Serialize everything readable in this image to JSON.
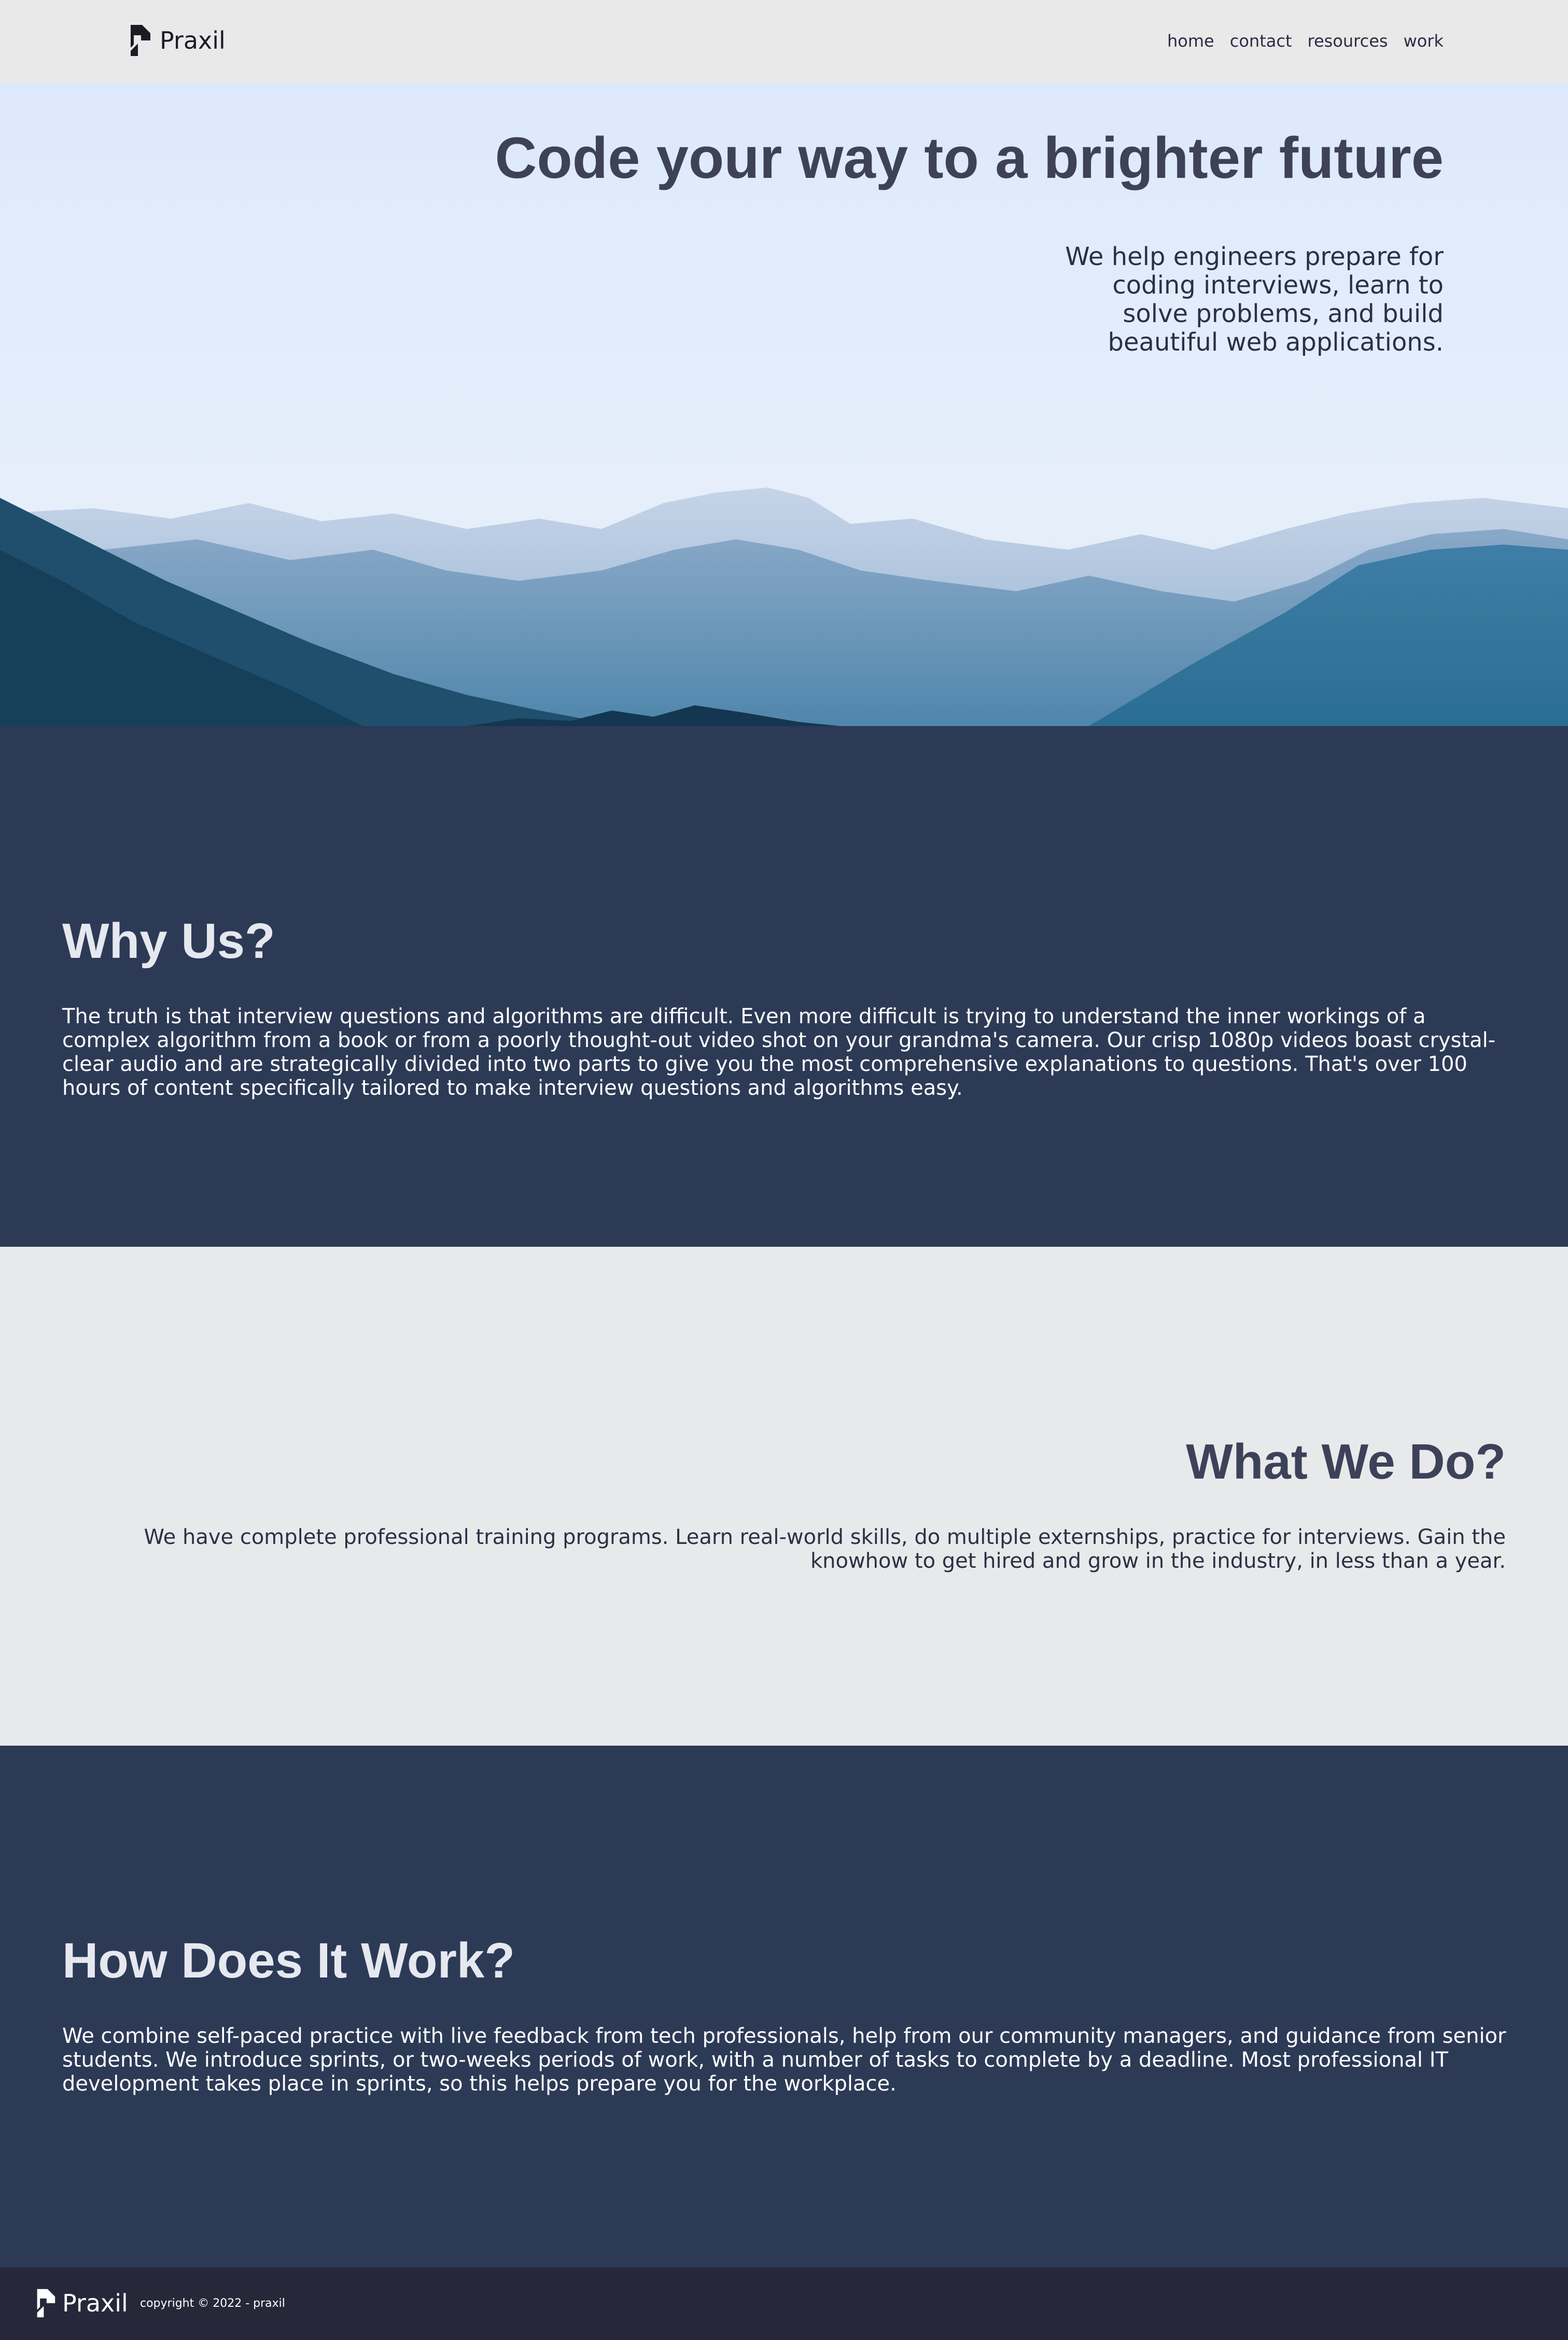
{
  "header": {
    "brand": "Praxil",
    "nav": [
      "home",
      "contact",
      "resources",
      "work"
    ]
  },
  "hero": {
    "title": "Code your way to a brighter future",
    "subtitle": "We help engineers prepare for coding interviews, learn to solve problems, and build beautiful web applications."
  },
  "why": {
    "title": "Why Us?",
    "text": "The truth is that interview questions and algorithms are difficult. Even more difficult is trying to understand the inner workings of a complex algorithm from a book or from a poorly thought-out video shot on your grandma's camera. Our crisp 1080p videos boast crystal-clear audio and are strategically divided into two parts to give you the most comprehensive explanations to questions. That's over 100 hours of content specifically tailored to make interview questions and algorithms easy."
  },
  "what": {
    "title": "What We Do?",
    "text": "We have complete professional training programs. Learn real-world skills, do multiple externships, practice for interviews. Gain the knowhow to get hired and grow in the industry, in less than a year."
  },
  "how": {
    "title": "How Does It Work?",
    "text": "We combine self-paced practice with live feedback from tech professionals, help from our community managers, and guidance from senior students. We introduce sprints, or two-weeks periods of work, with a number of tasks to complete by a deadline. Most professional IT development takes place in sprints, so this helps prepare you for the workplace."
  },
  "footer": {
    "brand": "Praxil",
    "copyright": "copyright © 2022 - praxil"
  },
  "colors": {
    "dark_section": "#2c3a56",
    "light_section": "#e8e9eb",
    "footer": "#26283a",
    "heading_dark": "#3d4259"
  }
}
